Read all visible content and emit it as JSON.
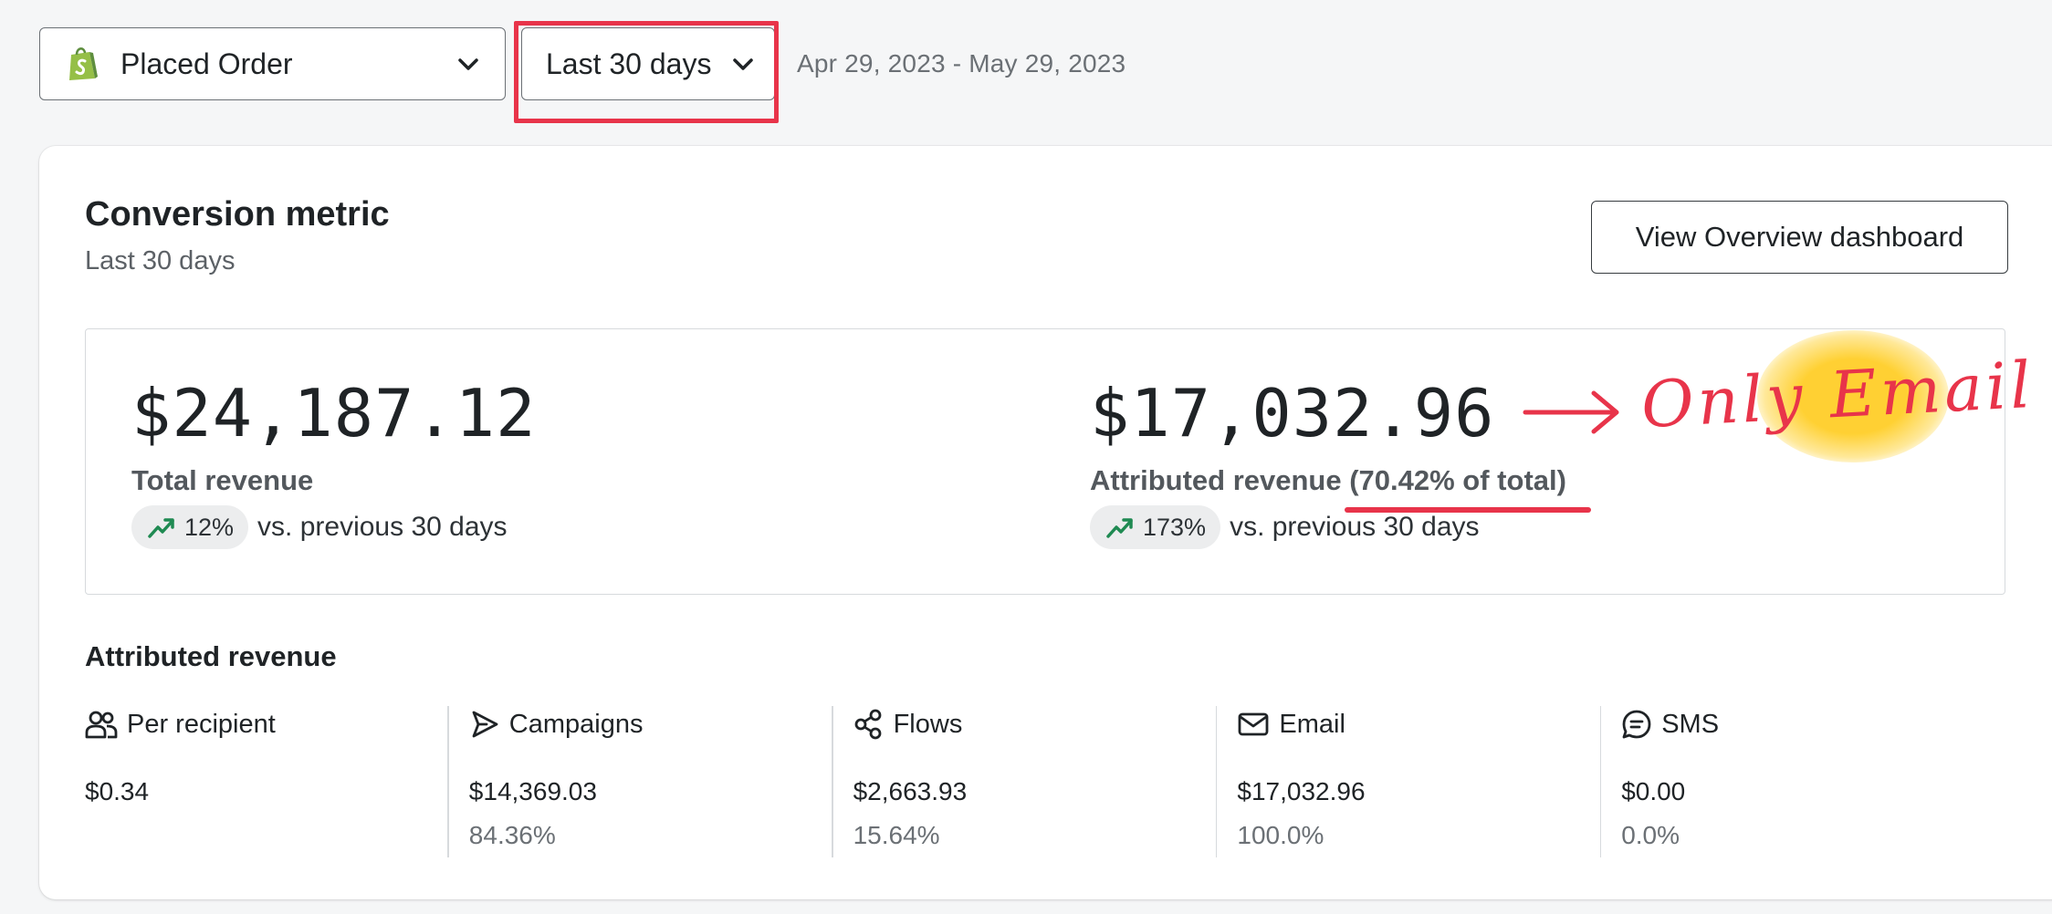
{
  "toolbar": {
    "metric_select_value": "Placed Order",
    "date_select_value": "Last 30 days",
    "date_range_text": "Apr 29, 2023 - May 29, 2023"
  },
  "card": {
    "title": "Conversion metric",
    "subtitle": "Last 30 days",
    "overview_button_label": "View Overview dashboard"
  },
  "revenue": {
    "total_value": "$24,187.12",
    "total_label": "Total revenue",
    "total_trend_pct": "12%",
    "total_trend_text": "vs. previous 30 days",
    "attributed_value": "$17,032.96",
    "attributed_label": "Attributed revenue",
    "attributed_share": "(70.42% of total)",
    "attributed_trend_pct": "173%",
    "attributed_trend_text": "vs. previous 30 days"
  },
  "annotation": {
    "text": "Only Email",
    "color": "#e8344a",
    "highlight_color": "#ffce28"
  },
  "attributed_section": {
    "title": "Attributed revenue",
    "stats": [
      {
        "icon": "users-icon",
        "label": "Per recipient",
        "value": "$0.34",
        "pct": ""
      },
      {
        "icon": "send-icon",
        "label": "Campaigns",
        "value": "$14,369.03",
        "pct": "84.36%"
      },
      {
        "icon": "flows-icon",
        "label": "Flows",
        "value": "$2,663.93",
        "pct": "15.64%"
      },
      {
        "icon": "envelope-icon",
        "label": "Email",
        "value": "$17,032.96",
        "pct": "100.0%"
      },
      {
        "icon": "sms-icon",
        "label": "SMS",
        "value": "$0.00",
        "pct": "0.0%"
      }
    ]
  },
  "colors": {
    "trend_up": "#1f8a52",
    "shopify_green": "#95bf47",
    "annotation_red": "#e8344a"
  }
}
